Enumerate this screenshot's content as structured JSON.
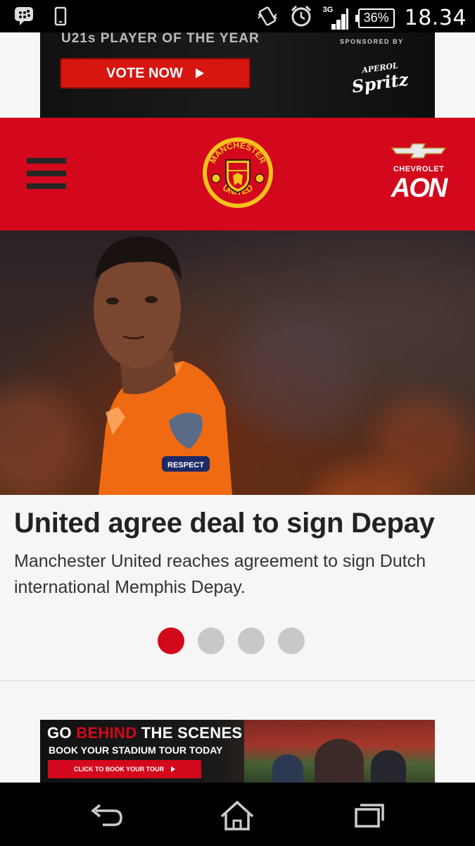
{
  "status_bar": {
    "time": "18.34",
    "battery": "36%",
    "network": "3G",
    "icons": [
      "blackberry-messenger-icon",
      "phone-icon",
      "vibrate-icon",
      "alarm-icon",
      "signal-icon",
      "battery-icon"
    ]
  },
  "top_ad": {
    "headline": "U21s PLAYER OF THE YEAR",
    "button_label": "VOTE NOW",
    "sponsor_label": "SPONSORED BY",
    "sponsor_line1": "APEROL",
    "sponsor_line2": "Spritz"
  },
  "header": {
    "menu_icon": "hamburger-menu-icon",
    "crest_text_top": "MANCHESTER",
    "crest_text_bottom": "UNITED",
    "sponsor1": "CHEVROLET",
    "sponsor2": "AON",
    "colors": {
      "brand_red": "#d3081c"
    }
  },
  "hero": {
    "image_subject": "player in orange jersey",
    "armband_text": "RESPECT"
  },
  "article": {
    "title": "United agree deal to sign Depay",
    "summary": "Manchester United reaches agreement to sign Dutch international Memphis Depay.",
    "slides_total": 4,
    "active_slide": 1
  },
  "bottom_ad": {
    "headline_part1": "GO ",
    "headline_highlight": "BEHIND",
    "headline_part2": " THE SCENES",
    "subline": "BOOK YOUR STADIUM TOUR TODAY",
    "cta": "CLICK TO BOOK YOUR TOUR"
  },
  "navbar": {
    "buttons": [
      "back-icon",
      "home-icon",
      "recent-apps-icon"
    ]
  }
}
